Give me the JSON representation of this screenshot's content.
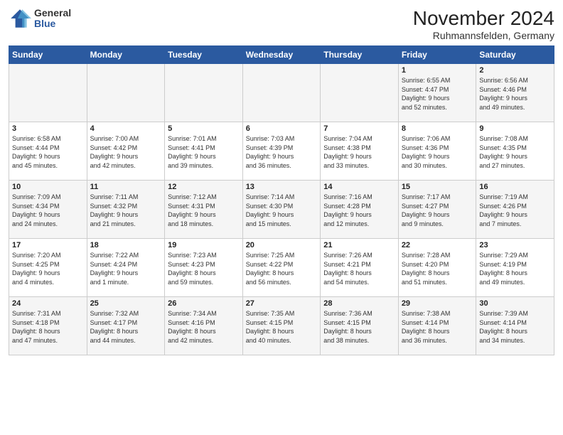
{
  "header": {
    "logo_general": "General",
    "logo_blue": "Blue",
    "month_title": "November 2024",
    "subtitle": "Ruhmannsfelden, Germany"
  },
  "days_of_week": [
    "Sunday",
    "Monday",
    "Tuesday",
    "Wednesday",
    "Thursday",
    "Friday",
    "Saturday"
  ],
  "weeks": [
    [
      {
        "day": "",
        "info": ""
      },
      {
        "day": "",
        "info": ""
      },
      {
        "day": "",
        "info": ""
      },
      {
        "day": "",
        "info": ""
      },
      {
        "day": "",
        "info": ""
      },
      {
        "day": "1",
        "info": "Sunrise: 6:55 AM\nSunset: 4:47 PM\nDaylight: 9 hours\nand 52 minutes."
      },
      {
        "day": "2",
        "info": "Sunrise: 6:56 AM\nSunset: 4:46 PM\nDaylight: 9 hours\nand 49 minutes."
      }
    ],
    [
      {
        "day": "3",
        "info": "Sunrise: 6:58 AM\nSunset: 4:44 PM\nDaylight: 9 hours\nand 45 minutes."
      },
      {
        "day": "4",
        "info": "Sunrise: 7:00 AM\nSunset: 4:42 PM\nDaylight: 9 hours\nand 42 minutes."
      },
      {
        "day": "5",
        "info": "Sunrise: 7:01 AM\nSunset: 4:41 PM\nDaylight: 9 hours\nand 39 minutes."
      },
      {
        "day": "6",
        "info": "Sunrise: 7:03 AM\nSunset: 4:39 PM\nDaylight: 9 hours\nand 36 minutes."
      },
      {
        "day": "7",
        "info": "Sunrise: 7:04 AM\nSunset: 4:38 PM\nDaylight: 9 hours\nand 33 minutes."
      },
      {
        "day": "8",
        "info": "Sunrise: 7:06 AM\nSunset: 4:36 PM\nDaylight: 9 hours\nand 30 minutes."
      },
      {
        "day": "9",
        "info": "Sunrise: 7:08 AM\nSunset: 4:35 PM\nDaylight: 9 hours\nand 27 minutes."
      }
    ],
    [
      {
        "day": "10",
        "info": "Sunrise: 7:09 AM\nSunset: 4:34 PM\nDaylight: 9 hours\nand 24 minutes."
      },
      {
        "day": "11",
        "info": "Sunrise: 7:11 AM\nSunset: 4:32 PM\nDaylight: 9 hours\nand 21 minutes."
      },
      {
        "day": "12",
        "info": "Sunrise: 7:12 AM\nSunset: 4:31 PM\nDaylight: 9 hours\nand 18 minutes."
      },
      {
        "day": "13",
        "info": "Sunrise: 7:14 AM\nSunset: 4:30 PM\nDaylight: 9 hours\nand 15 minutes."
      },
      {
        "day": "14",
        "info": "Sunrise: 7:16 AM\nSunset: 4:28 PM\nDaylight: 9 hours\nand 12 minutes."
      },
      {
        "day": "15",
        "info": "Sunrise: 7:17 AM\nSunset: 4:27 PM\nDaylight: 9 hours\nand 9 minutes."
      },
      {
        "day": "16",
        "info": "Sunrise: 7:19 AM\nSunset: 4:26 PM\nDaylight: 9 hours\nand 7 minutes."
      }
    ],
    [
      {
        "day": "17",
        "info": "Sunrise: 7:20 AM\nSunset: 4:25 PM\nDaylight: 9 hours\nand 4 minutes."
      },
      {
        "day": "18",
        "info": "Sunrise: 7:22 AM\nSunset: 4:24 PM\nDaylight: 9 hours\nand 1 minute."
      },
      {
        "day": "19",
        "info": "Sunrise: 7:23 AM\nSunset: 4:23 PM\nDaylight: 8 hours\nand 59 minutes."
      },
      {
        "day": "20",
        "info": "Sunrise: 7:25 AM\nSunset: 4:22 PM\nDaylight: 8 hours\nand 56 minutes."
      },
      {
        "day": "21",
        "info": "Sunrise: 7:26 AM\nSunset: 4:21 PM\nDaylight: 8 hours\nand 54 minutes."
      },
      {
        "day": "22",
        "info": "Sunrise: 7:28 AM\nSunset: 4:20 PM\nDaylight: 8 hours\nand 51 minutes."
      },
      {
        "day": "23",
        "info": "Sunrise: 7:29 AM\nSunset: 4:19 PM\nDaylight: 8 hours\nand 49 minutes."
      }
    ],
    [
      {
        "day": "24",
        "info": "Sunrise: 7:31 AM\nSunset: 4:18 PM\nDaylight: 8 hours\nand 47 minutes."
      },
      {
        "day": "25",
        "info": "Sunrise: 7:32 AM\nSunset: 4:17 PM\nDaylight: 8 hours\nand 44 minutes."
      },
      {
        "day": "26",
        "info": "Sunrise: 7:34 AM\nSunset: 4:16 PM\nDaylight: 8 hours\nand 42 minutes."
      },
      {
        "day": "27",
        "info": "Sunrise: 7:35 AM\nSunset: 4:15 PM\nDaylight: 8 hours\nand 40 minutes."
      },
      {
        "day": "28",
        "info": "Sunrise: 7:36 AM\nSunset: 4:15 PM\nDaylight: 8 hours\nand 38 minutes."
      },
      {
        "day": "29",
        "info": "Sunrise: 7:38 AM\nSunset: 4:14 PM\nDaylight: 8 hours\nand 36 minutes."
      },
      {
        "day": "30",
        "info": "Sunrise: 7:39 AM\nSunset: 4:14 PM\nDaylight: 8 hours\nand 34 minutes."
      }
    ]
  ]
}
